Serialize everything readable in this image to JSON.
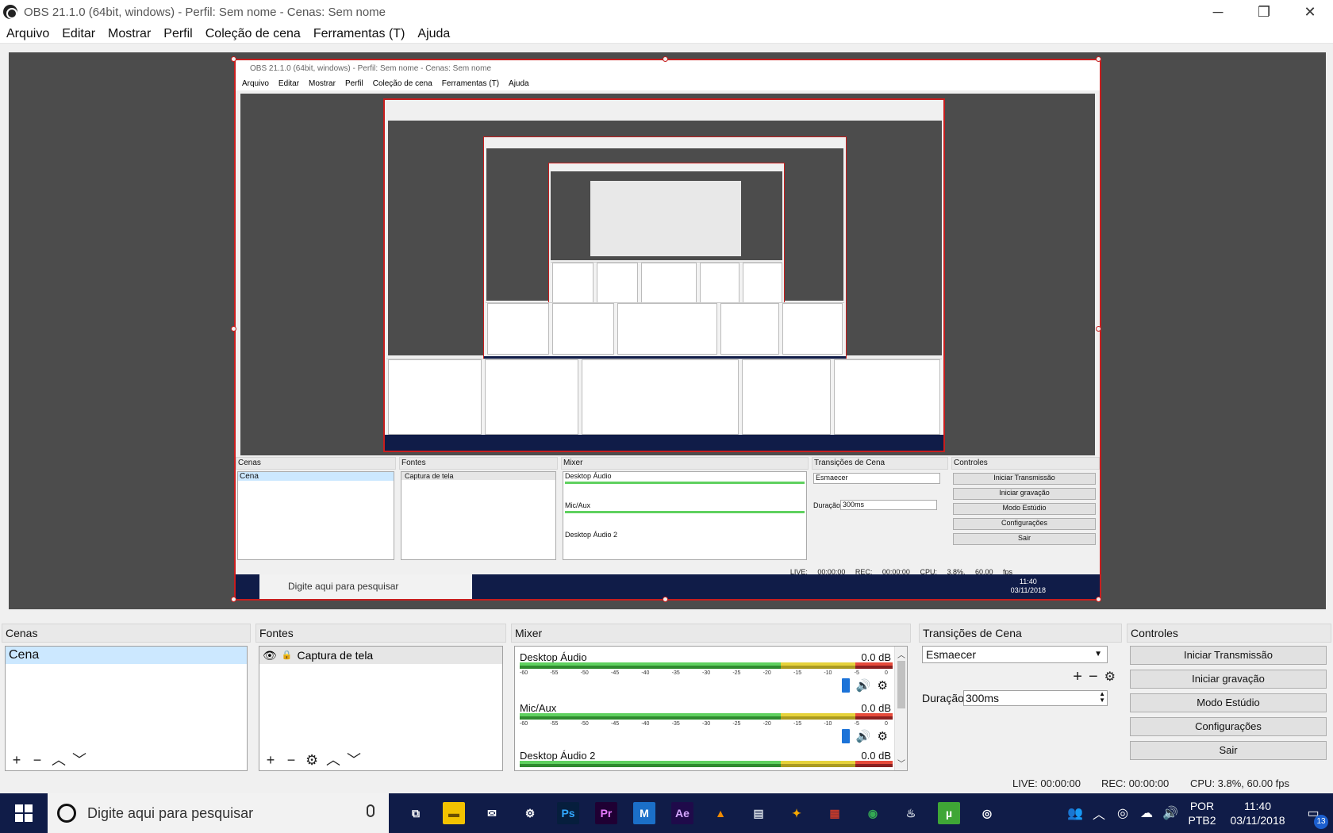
{
  "window": {
    "title": "OBS 21.1.0 (64bit, windows) - Perfil: Sem nome - Cenas: Sem nome",
    "minimize": "─",
    "maximize": "❐",
    "close": "✕"
  },
  "menu": [
    "Arquivo",
    "Editar",
    "Mostrar",
    "Perfil",
    "Coleção de cena",
    "Ferramentas (T)",
    "Ajuda"
  ],
  "scenes": {
    "header": "Cenas",
    "items": [
      "Cena"
    ],
    "tools": [
      "+",
      "−",
      "︿",
      "﹀"
    ]
  },
  "sources": {
    "header": "Fontes",
    "items": [
      {
        "name": "Captura de tela",
        "visible_icon": "👁",
        "lock_icon": "🔒"
      }
    ],
    "tools": [
      "+",
      "−",
      "⚙",
      "︿",
      "﹀"
    ]
  },
  "mixer": {
    "header": "Mixer",
    "scale": [
      "-60",
      "-55",
      "-50",
      "-45",
      "-40",
      "-35",
      "-30",
      "-25",
      "-20",
      "-15",
      "-10",
      "-5",
      "0"
    ],
    "channels": [
      {
        "name": "Desktop Áudio",
        "db": "0.0 dB"
      },
      {
        "name": "Mic/Aux",
        "db": "0.0 dB"
      },
      {
        "name": "Desktop Áudio 2",
        "db": "0.0 dB"
      }
    ],
    "speaker_icon": "🔊",
    "gear_icon": "⚙"
  },
  "transitions": {
    "header": "Transições de Cena",
    "selected": "Esmaecer",
    "add": "+",
    "remove": "−",
    "gear": "⚙",
    "duration_label": "Duração",
    "duration_value": "300ms"
  },
  "controls": {
    "header": "Controles",
    "buttons": [
      "Iniciar Transmissão",
      "Iniciar gravação",
      "Modo Estúdio",
      "Configurações",
      "Sair"
    ]
  },
  "status": {
    "live": "LIVE: 00:00:00",
    "rec": "REC: 00:00:00",
    "cpu": "CPU: 3.8%, 60.00 fps"
  },
  "taskbar": {
    "search_placeholder": "Digite aqui para pesquisar",
    "apps": [
      {
        "name": "task-view",
        "label": "⧉",
        "bg": "transparent",
        "fg": "#ffffff"
      },
      {
        "name": "file-explorer",
        "label": "▬",
        "bg": "#f2c200",
        "fg": "#6b4e00"
      },
      {
        "name": "mail",
        "label": "✉",
        "bg": "transparent",
        "fg": "#ffffff"
      },
      {
        "name": "settings",
        "label": "⚙",
        "bg": "transparent",
        "fg": "#ffffff"
      },
      {
        "name": "photoshop",
        "label": "Ps",
        "bg": "#061e3d",
        "fg": "#31a8ff"
      },
      {
        "name": "premiere",
        "label": "Pr",
        "bg": "#1f0033",
        "fg": "#e77bff"
      },
      {
        "name": "media-app",
        "label": "M",
        "bg": "#1b6fc8",
        "fg": "#ffffff"
      },
      {
        "name": "after-effects",
        "label": "Ae",
        "bg": "#1f0a4a",
        "fg": "#d4a6ff"
      },
      {
        "name": "app-hat",
        "label": "▲",
        "bg": "transparent",
        "fg": "#f08a00"
      },
      {
        "name": "app-disk",
        "label": "▤",
        "bg": "transparent",
        "fg": "#cfd6e0"
      },
      {
        "name": "fl-studio",
        "label": "✦",
        "bg": "transparent",
        "fg": "#f7a800"
      },
      {
        "name": "app-flag",
        "label": "▦",
        "bg": "transparent",
        "fg": "#c0392b"
      },
      {
        "name": "chrome",
        "label": "◉",
        "bg": "transparent",
        "fg": "#34a853"
      },
      {
        "name": "steam",
        "label": "♨",
        "bg": "transparent",
        "fg": "#cfd6e0"
      },
      {
        "name": "utorrent",
        "label": "µ",
        "bg": "#3fa636",
        "fg": "#ffffff"
      },
      {
        "name": "obs",
        "label": "◎",
        "bg": "transparent",
        "fg": "#ffffff"
      }
    ],
    "tray": [
      "👥",
      "︿",
      "◎",
      "☁",
      "🔊"
    ],
    "lang_top": "POR",
    "lang_bottom": "PTB2",
    "time": "11:40",
    "date": "03/11/2018",
    "notif_count": "13"
  },
  "colors": {
    "selection_red": "#c81e1e",
    "taskbar_bg": "#101c48",
    "selected_item": "#cce8ff",
    "volume_knob": "#1c73d8"
  }
}
